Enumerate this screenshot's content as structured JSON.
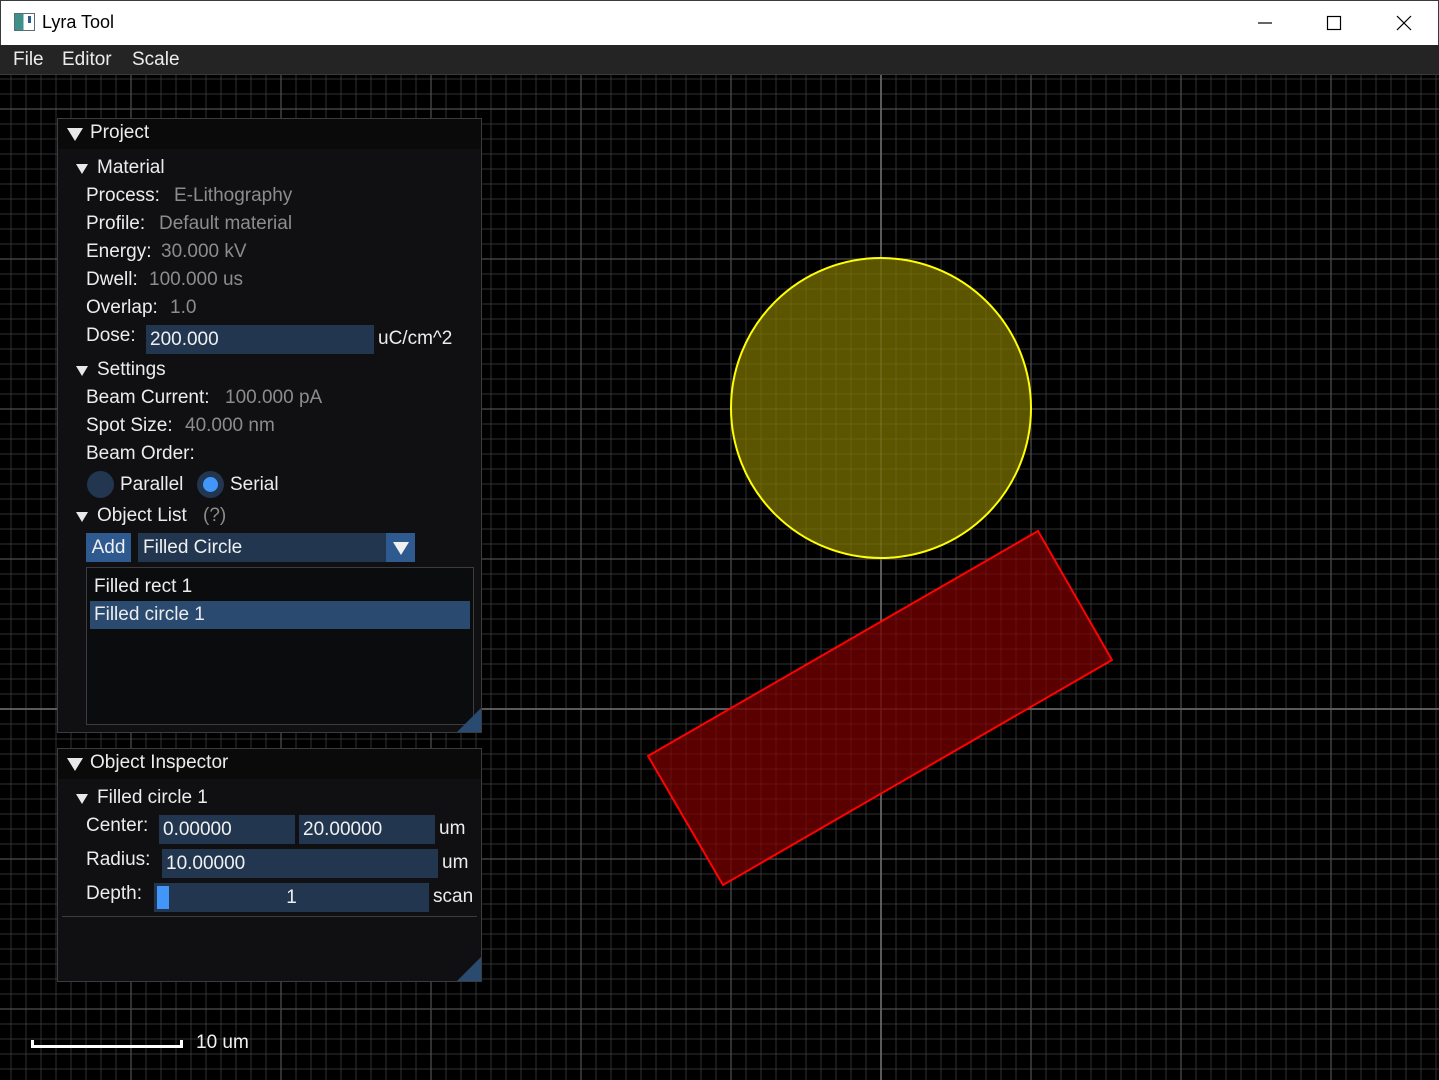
{
  "window": {
    "title": "Lyra Tool",
    "controls": [
      "minimize",
      "maximize",
      "close"
    ]
  },
  "menu": {
    "items": [
      "File",
      "Editor",
      "Scale"
    ]
  },
  "project_panel": {
    "title": "Project",
    "material": {
      "header": "Material",
      "process_label": "Process:",
      "process_value": "E-Lithography",
      "profile_label": "Profile:",
      "profile_value": "Default material",
      "energy_label": "Energy:",
      "energy_value": "30.000 kV",
      "dwell_label": "Dwell:",
      "dwell_value": "100.000 us",
      "overlap_label": "Overlap:",
      "overlap_value": "1.0",
      "dose_label": "Dose:",
      "dose_value": "200.000",
      "dose_unit": "uC/cm^2"
    },
    "settings": {
      "header": "Settings",
      "beam_current_label": "Beam Current:",
      "beam_current_value": "100.000 pA",
      "spot_size_label": "Spot Size:",
      "spot_size_value": "40.000 nm",
      "beam_order_label": "Beam Order:",
      "option_parallel": "Parallel",
      "option_serial": "Serial",
      "selected_order": "Serial"
    },
    "object_list": {
      "header": "Object List",
      "help": "(?)",
      "add_label": "Add",
      "add_type": "Filled Circle",
      "items": [
        "Filled rect 1",
        "Filled circle 1"
      ],
      "selected": "Filled circle 1"
    }
  },
  "inspector_panel": {
    "title": "Object Inspector",
    "object_header": "Filled circle 1",
    "center_label": "Center:",
    "center_x": "0.00000",
    "center_y": "20.00000",
    "center_unit": "um",
    "radius_label": "Radius:",
    "radius_value": "10.00000",
    "radius_unit": "um",
    "depth_label": "Depth:",
    "depth_value": "1",
    "depth_unit": "scan"
  },
  "scale_bar": {
    "label": "10 um"
  },
  "colors": {
    "circle_fill": "#6b6400",
    "circle_stroke": "#ffff00",
    "rect_fill": "#6a0000",
    "rect_stroke": "#ff0000",
    "accent": "#4296fa",
    "field_bg": "#223650"
  }
}
